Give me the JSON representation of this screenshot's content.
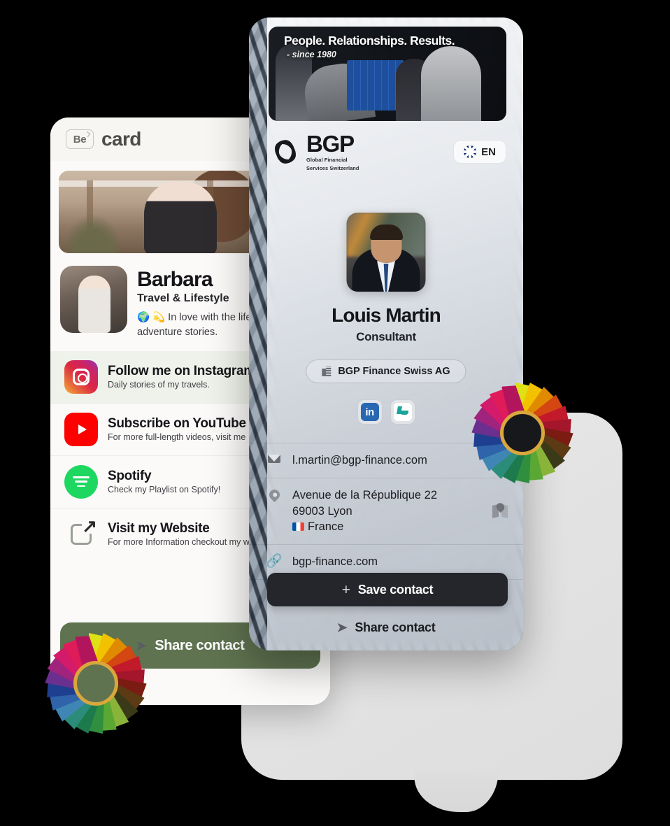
{
  "left_card": {
    "header": {
      "badge": "Be",
      "word": "card"
    },
    "profile": {
      "name": "Barbara",
      "role": "Travel & Lifestyle",
      "bio": "🌍 💫 In love with the life. My life, my adventure stories."
    },
    "links": [
      {
        "title": "Follow me on Instagram",
        "subtitle": "Daily stories of my travels.",
        "icon": "instagram-icon"
      },
      {
        "title": "Subscribe on YouTube",
        "subtitle": "For more full-length videos, visit me",
        "icon": "youtube-icon"
      },
      {
        "title": "Spotify",
        "subtitle": "Check my Playlist on Spotify!",
        "icon": "spotify-icon"
      },
      {
        "title": "Visit my Website",
        "subtitle": "For more Information checkout my website",
        "icon": "external-link-icon"
      }
    ],
    "share_label": "Share contact"
  },
  "phone_card": {
    "banner": {
      "title": "People. Relationships. Results.",
      "subtitle": "- since 1980"
    },
    "brand": {
      "name": "BGP",
      "tagline_line1": "Global Financial",
      "tagline_line2": "Services Switzerland"
    },
    "language": {
      "code": "EN",
      "flag": "uk-flag-icon"
    },
    "person": {
      "name": "Louis Martin",
      "role": "Consultant",
      "company": "BGP Finance Swiss AG"
    },
    "socials": [
      {
        "name": "linkedin-icon",
        "label": "in"
      },
      {
        "name": "xing-icon",
        "label": ""
      }
    ],
    "contacts": {
      "email": "l.martin@bgp-finance.com",
      "address_line1": "Avenue de la République 22",
      "address_line2": "69003 Lyon",
      "address_country": "France",
      "website": "bgp-finance.com"
    },
    "save_label": "Save contact",
    "save_plus": "+",
    "share_label": "Share contact",
    "share_arrow": "➤"
  },
  "colors": {
    "dark_button": "#24262b",
    "green_button": "#5f7350",
    "gold_ring": "#d9a73c",
    "linkedin_blue": "#2867B2",
    "spotify_green": "#1ed760",
    "youtube_red": "#ff0000"
  },
  "wheel_blades": [
    "#dfe016",
    "#f2c200",
    "#e08a00",
    "#d44612",
    "#c21a2b",
    "#a3162b",
    "#7a1c12",
    "#5c3a14",
    "#3b3a18",
    "#8ab33a",
    "#5aa734",
    "#2f8f3f",
    "#1d7a4d",
    "#2c8c7a",
    "#3f86b5",
    "#2f63aa",
    "#1e3f8f",
    "#6a2f8f",
    "#a0237e",
    "#d31a6b",
    "#e01b5a",
    "#b3155c"
  ]
}
